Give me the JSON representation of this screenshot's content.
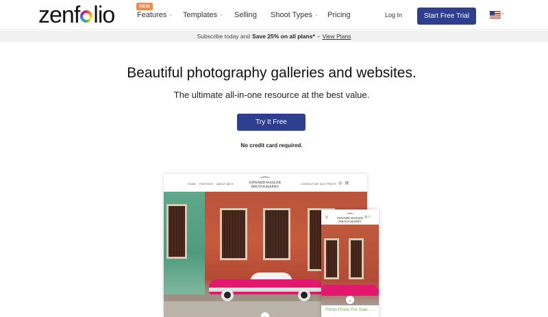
{
  "brand": {
    "logo_text_left": "zen",
    "logo_text_right": "lio",
    "logo_f": "f"
  },
  "header": {
    "badge": "NEW",
    "nav": [
      {
        "label": "Features",
        "has_dropdown": true
      },
      {
        "label": "Templates",
        "has_dropdown": true
      },
      {
        "label": "Selling",
        "has_dropdown": false
      },
      {
        "label": "Shoot Types",
        "has_dropdown": true
      },
      {
        "label": "Pricing",
        "has_dropdown": false
      }
    ],
    "login": "Log In",
    "cta": "Start Free Trial",
    "language_flag": "us-flag-icon"
  },
  "promo": {
    "prefix": "Subscribe today and",
    "bold": "Save 25% on all plans*",
    "separator": "–",
    "link": "View Plans"
  },
  "hero": {
    "title": "Beautiful photography galleries and websites.",
    "subtitle": "The ultimate all-in-one resource at the best value.",
    "button": "Try It Free",
    "note": "No credit card required."
  },
  "mockup_desktop": {
    "nav_left": [
      "HOME",
      "PHOTOS ▾",
      "ABOUT ME ▾"
    ],
    "nav_right": [
      "CONTACT ME",
      "BUY PRINTS"
    ],
    "site_title_line1": "EDWARD HASLER",
    "site_title_line2": "PHOTOGRAPHY"
  },
  "mockup_mobile": {
    "site_title_line1": "EDWARD HASLER",
    "site_title_line2": "PHOTOGRAPHY",
    "caption": "Photo Prints For Sale - ..."
  },
  "colors": {
    "primary_button": "#2e3f8f",
    "badge": "#f08a4b",
    "promo_bg": "#f1f1f1"
  }
}
